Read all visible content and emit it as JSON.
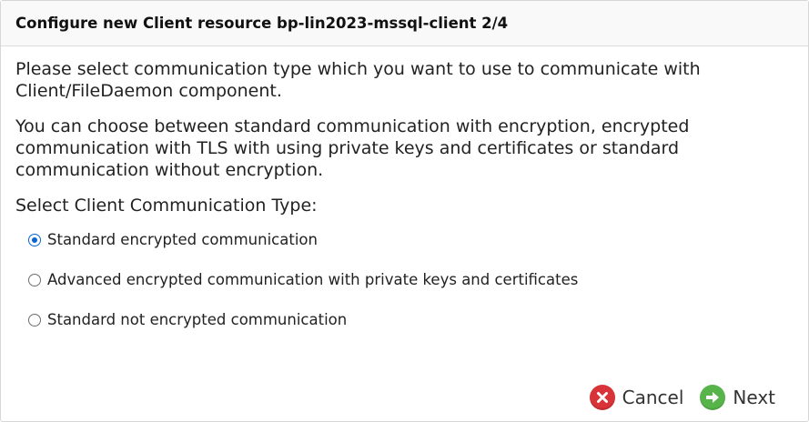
{
  "dialog": {
    "title": "Configure new Client resource bp-lin2023-mssql-client 2/4"
  },
  "content": {
    "paragraph1": "Please select communication type which you want to use to communicate with Client/FileDaemon component.",
    "paragraph2": "You can choose between standard communication with encryption, encrypted communication with TLS with using private keys and certificates or standard communication without encryption.",
    "section_label": "Select Client Communication Type:",
    "options": [
      {
        "label": "Standard encrypted communication",
        "checked": true
      },
      {
        "label": "Advanced encrypted communication with private keys and certificates",
        "checked": false
      },
      {
        "label": "Standard not encrypted communication",
        "checked": false
      }
    ]
  },
  "footer": {
    "cancel_label": "Cancel",
    "next_label": "Next",
    "cancel_icon": "cancel-x-icon",
    "next_icon": "next-arrow-icon"
  },
  "colors": {
    "radio_selected": "#0a64d6",
    "cancel_icon_bg": "#d9333a",
    "next_icon_bg": "#56b44a"
  }
}
